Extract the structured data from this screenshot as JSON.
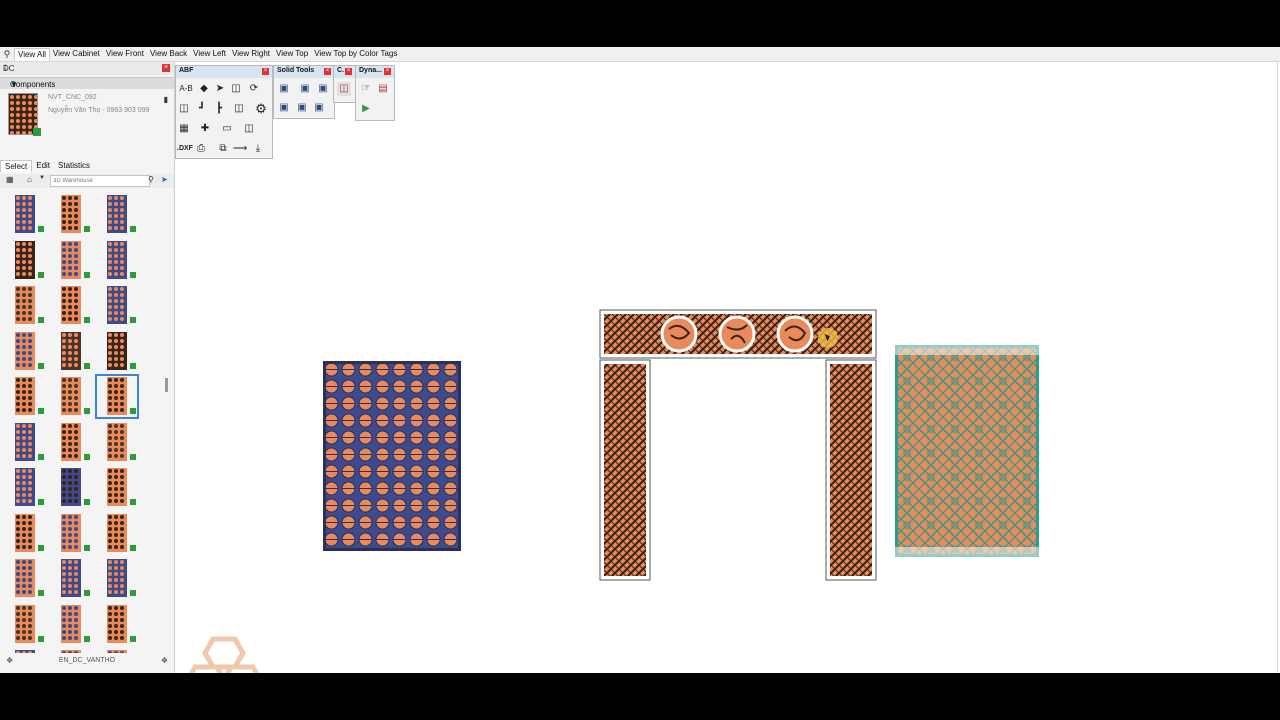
{
  "tabs": [
    "View All",
    "View Cabinet",
    "View Front",
    "View Back",
    "View Left",
    "View Right",
    "View Top",
    "View Top by Color Tags"
  ],
  "panel": {
    "title": "DC",
    "section": "Components",
    "component_name": "NVT_CNC_092",
    "component_desc": "Nguyễn Văn Thọ - 0963 903 099",
    "tabs": [
      "Select",
      "Edit",
      "Statistics"
    ],
    "search_placeholder": "3D Warehouse",
    "footer": "EN_DC_VANTHO"
  },
  "toolbars": {
    "abf": "ABF",
    "solid": "Solid Tools",
    "c": "C.",
    "dyna": "Dyna...",
    "dxf": ".DXF",
    "ab": "A-B"
  },
  "colors": {
    "wood": "#e98a5b",
    "dark": "#3b2417",
    "blue": "#3e4a8c",
    "teal": "#2a9d8f",
    "frame": "#4a3328"
  }
}
